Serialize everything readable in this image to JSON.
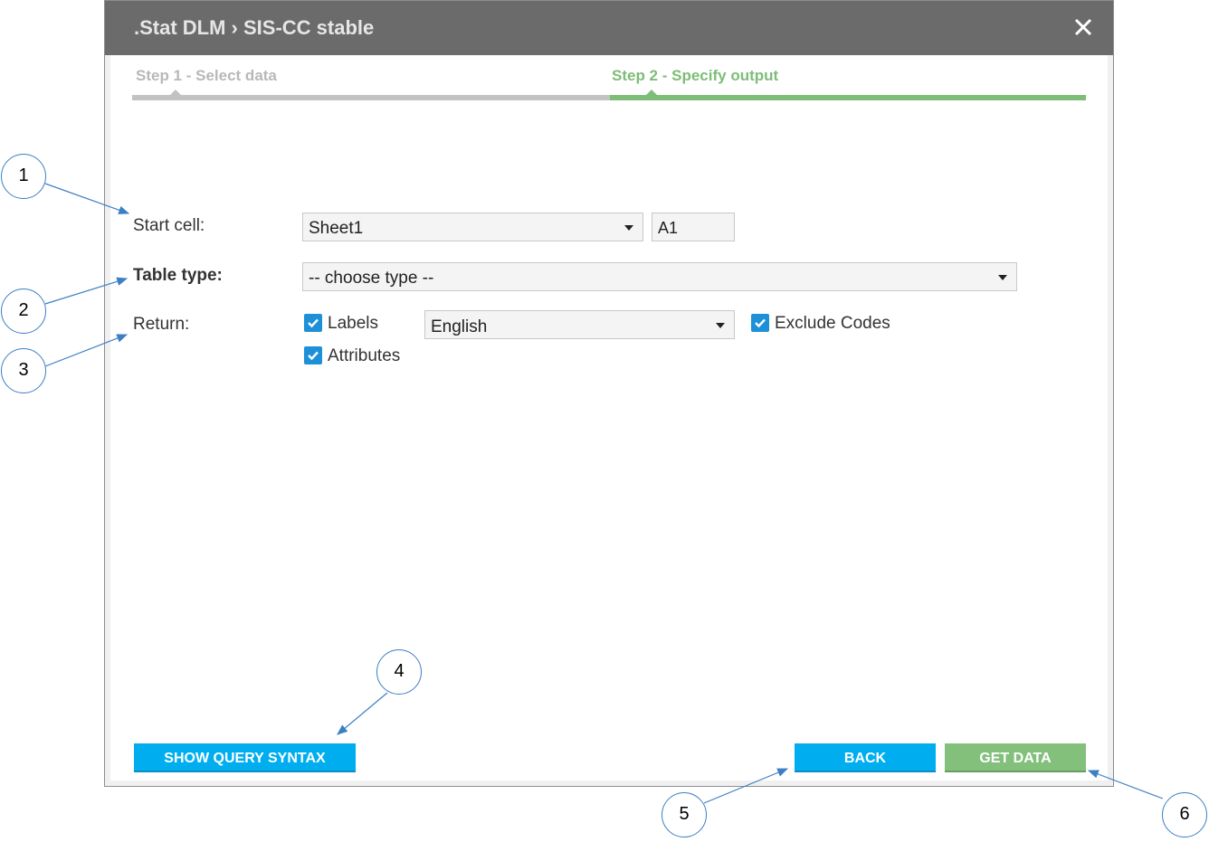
{
  "window": {
    "title": ".Stat DLM › SIS-CC stable",
    "close_icon": "close-icon"
  },
  "steps": [
    {
      "label": "Step 1 - Select data",
      "state": "inactive"
    },
    {
      "label": "Step 2 - Specify output",
      "state": "active"
    }
  ],
  "form": {
    "start_cell": {
      "label": "Start cell:",
      "sheet_value": "Sheet1",
      "cell_value": "A1"
    },
    "table_type": {
      "label": "Table type:",
      "value": "-- choose type --"
    },
    "return": {
      "label": "Return:",
      "labels_checkbox": {
        "label": "Labels",
        "checked": true
      },
      "language_value": "English",
      "exclude_codes_checkbox": {
        "label": "Exclude Codes",
        "checked": true
      },
      "attributes_checkbox": {
        "label": "Attributes",
        "checked": true
      }
    }
  },
  "buttons": {
    "show_query_syntax": "SHOW QUERY SYNTAX",
    "back": "BACK",
    "get_data": "GET DATA"
  },
  "callouts": [
    "1",
    "2",
    "3",
    "4",
    "5",
    "6"
  ],
  "colors": {
    "titlebar": "#6b6b6b",
    "step_active": "#7dbd78",
    "step_inactive": "#c2c2c2",
    "button_blue": "#00aef0",
    "button_green": "#82c07c",
    "checkbox": "#1e90d8",
    "callout_stroke": "#3d7fc4"
  }
}
